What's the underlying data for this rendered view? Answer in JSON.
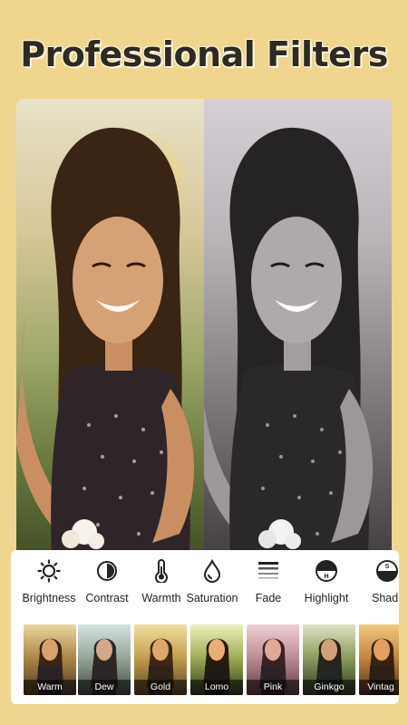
{
  "headline": "Professional Filters",
  "tools": [
    {
      "label": "Brightness",
      "icon": "brightness-icon"
    },
    {
      "label": "Contrast",
      "icon": "contrast-icon"
    },
    {
      "label": "Warmth",
      "icon": "thermometer-icon"
    },
    {
      "label": "Saturation",
      "icon": "drop-icon"
    },
    {
      "label": "Fade",
      "icon": "fade-lines-icon"
    },
    {
      "label": "Highlight",
      "icon": "highlight-icon"
    },
    {
      "label": "Shad",
      "icon": "shadow-icon"
    }
  ],
  "filters": [
    {
      "label": "Warm"
    },
    {
      "label": "Dew"
    },
    {
      "label": "Gold"
    },
    {
      "label": "Lomo"
    },
    {
      "label": "Pink"
    },
    {
      "label": "Ginkgo"
    },
    {
      "label": "Vintag"
    }
  ],
  "colors": {
    "background": "#f0d58e",
    "panel": "#ffffff",
    "text": "#222222"
  }
}
